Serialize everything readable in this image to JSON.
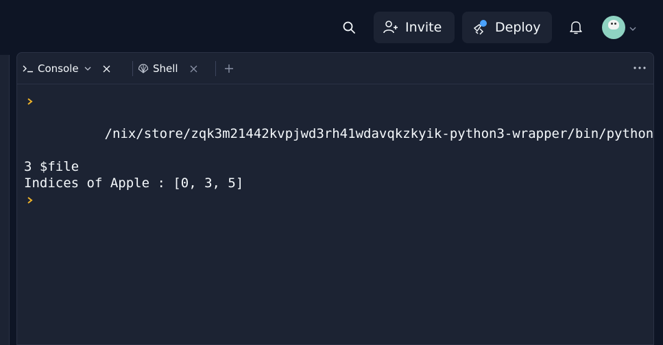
{
  "header": {
    "invite_label": "Invite",
    "deploy_label": "Deploy",
    "icons": [
      "search-icon",
      "add-user-icon",
      "deploy-icon",
      "bell-icon",
      "avatar",
      "chevron-down-icon"
    ]
  },
  "tabs": [
    {
      "label": "Console",
      "icon": "terminal-icon",
      "active": true
    },
    {
      "label": "Shell",
      "icon": "shell-icon",
      "active": false
    }
  ],
  "console": {
    "lines": [
      "/nix/store/zqk3m21442kvpjwd3rh41wdavqkzkyik-python3-wrapper/bin/python",
      "3 $file",
      "Indices of Apple : [0, 3, 5]",
      ""
    ]
  },
  "colors": {
    "background": "#0e1525",
    "panel": "#1c2333",
    "text": "#f5f9fc",
    "prompt": "#f0b429",
    "deploy_badge": "#4aa3ff"
  }
}
